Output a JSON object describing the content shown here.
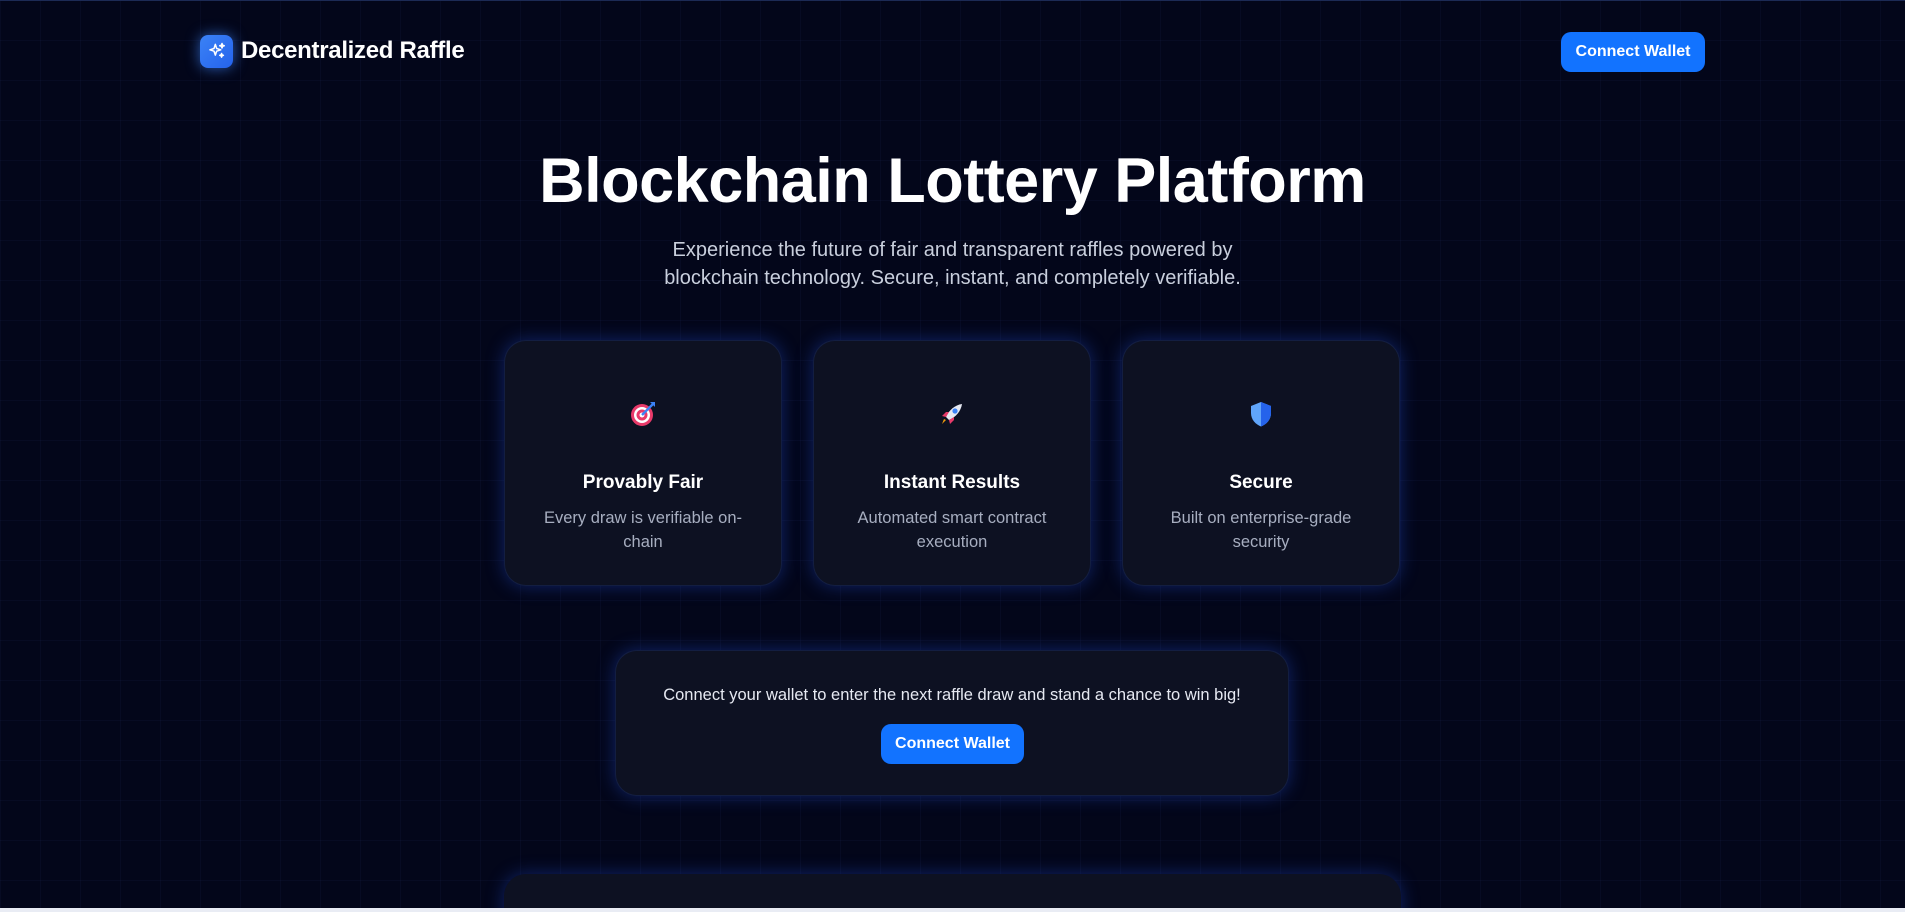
{
  "header": {
    "brand_title": "Decentralized Raffle",
    "connect_label": "Connect Wallet"
  },
  "hero": {
    "title": "Blockchain Lottery Platform",
    "subtitle": "Experience the future of fair and transparent raffles powered by blockchain technology. Secure, instant, and completely verifiable."
  },
  "features": [
    {
      "icon": "target-icon",
      "title": "Provably Fair",
      "description": "Every draw is verifiable on-chain"
    },
    {
      "icon": "rocket-icon",
      "title": "Instant Results",
      "description": "Automated smart contract execution"
    },
    {
      "icon": "shield-icon",
      "title": "Secure",
      "description": "Built on enterprise-grade security"
    }
  ],
  "connect_panel": {
    "message": "Connect your wallet to enter the next raffle draw and stand a chance to win big!",
    "button_label": "Connect Wallet"
  },
  "colors": {
    "accent": "#1273ff",
    "background": "#03061a",
    "card": "#0d1122"
  }
}
